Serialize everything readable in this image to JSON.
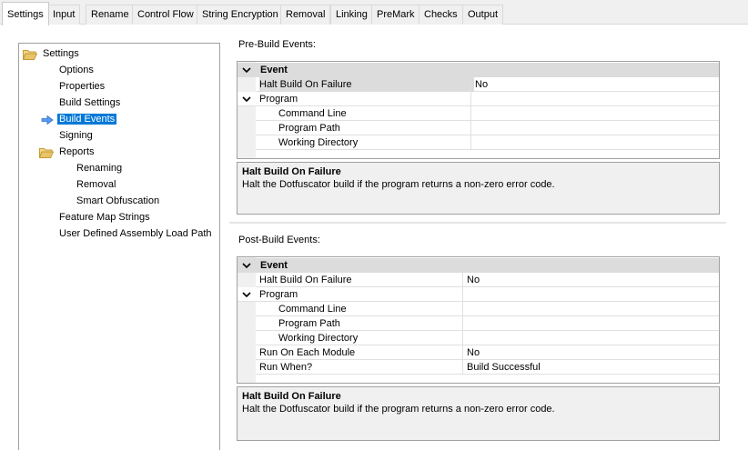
{
  "tabs": [
    {
      "label": "Settings",
      "active": true
    },
    {
      "label": "Input",
      "active": false
    },
    {
      "label": "Rename",
      "active": false
    },
    {
      "label": "Control Flow",
      "active": false
    },
    {
      "label": "String Encryption",
      "active": false
    },
    {
      "label": "Removal",
      "active": false
    },
    {
      "label": "Linking",
      "active": false
    },
    {
      "label": "PreMark",
      "active": false
    },
    {
      "label": "Checks",
      "active": false
    },
    {
      "label": "Output",
      "active": false
    }
  ],
  "tree": {
    "root": "Settings",
    "items": {
      "options": "Options",
      "properties": "Properties",
      "build_settings": "Build Settings",
      "build_events": "Build Events",
      "signing": "Signing",
      "reports": "Reports",
      "renaming": "Renaming",
      "removal": "Removal",
      "smart_obfuscation": "Smart Obfuscation",
      "feature_map_strings": "Feature Map Strings",
      "user_defined_load_path": "User Defined Assembly Load Path"
    },
    "selected": "Build Events"
  },
  "pre_build": {
    "title": "Pre-Build Events:",
    "category": "Event",
    "halt_label": "Halt Build On Failure",
    "halt_value": "No",
    "program_label": "Program",
    "command_line_label": "Command Line",
    "command_line_value": "",
    "program_path_label": "Program Path",
    "program_path_value": "",
    "working_dir_label": "Working Directory",
    "working_dir_value": "",
    "help_title": "Halt Build On Failure",
    "help_desc": "Halt the Dotfuscator build if the program returns a non-zero error code."
  },
  "post_build": {
    "title": "Post-Build Events:",
    "category": "Event",
    "halt_label": "Halt Build On Failure",
    "halt_value": "No",
    "program_label": "Program",
    "command_line_label": "Command Line",
    "command_line_value": "",
    "program_path_label": "Program Path",
    "program_path_value": "",
    "working_dir_label": "Working Directory",
    "working_dir_value": "",
    "run_each_label": "Run On Each Module",
    "run_each_value": "No",
    "run_when_label": "Run When?",
    "run_when_value": "Build Successful",
    "help_title": "Halt Build On Failure",
    "help_desc": "Halt the Dotfuscator build if the program returns a non-zero error code."
  },
  "icons": {
    "folder": "folder-open-icon",
    "selection_arrow": "arrow-right-icon",
    "collapse": "chevron-down-icon"
  },
  "colors": {
    "selection": "#0078d7",
    "folder": "#e8c46a",
    "arrow": "#2b6fd6"
  }
}
